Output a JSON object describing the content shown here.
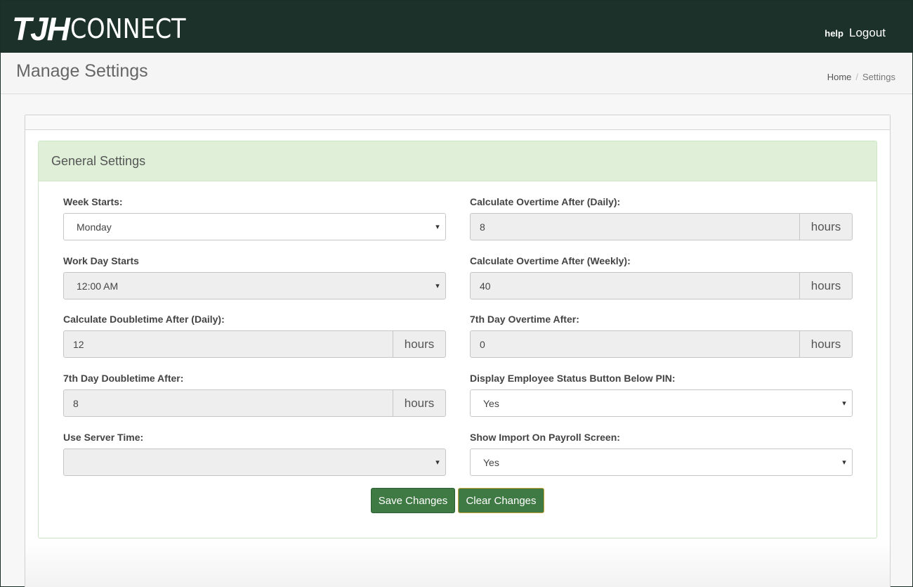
{
  "header": {
    "logo_brand": "TJH",
    "logo_word": "CONNECT",
    "help_label": "help",
    "logout_label": "Logout"
  },
  "titlebar": {
    "title": "Manage Settings",
    "breadcrumb_home": "Home",
    "breadcrumb_sep": "/",
    "breadcrumb_current": "Settings"
  },
  "panel": {
    "title": "General Settings"
  },
  "fields": {
    "week_starts": {
      "label": "Week Starts:",
      "value": "Monday"
    },
    "work_day_starts": {
      "label": "Work Day Starts",
      "value": "12:00 AM"
    },
    "doubletime_daily": {
      "label": "Calculate Doubletime After (Daily):",
      "value": "12",
      "unit": "hours"
    },
    "seventh_doubletime": {
      "label": "7th Day Doubletime After:",
      "value": "8",
      "unit": "hours"
    },
    "use_server_time": {
      "label": "Use Server Time:",
      "value": ""
    },
    "overtime_daily": {
      "label": "Calculate Overtime After (Daily):",
      "value": "8",
      "unit": "hours"
    },
    "overtime_weekly": {
      "label": "Calculate Overtime After (Weekly):",
      "value": "40",
      "unit": "hours"
    },
    "seventh_overtime": {
      "label": "7th Day Overtime After:",
      "value": "0",
      "unit": "hours"
    },
    "display_status_button": {
      "label": "Display Employee Status Button Below PIN:",
      "value": "Yes"
    },
    "show_import": {
      "label": "Show Import On Payroll Screen:",
      "value": "Yes"
    }
  },
  "buttons": {
    "save": "Save Changes",
    "clear": "Clear Changes"
  },
  "icons": {
    "select_caret": "▾"
  }
}
